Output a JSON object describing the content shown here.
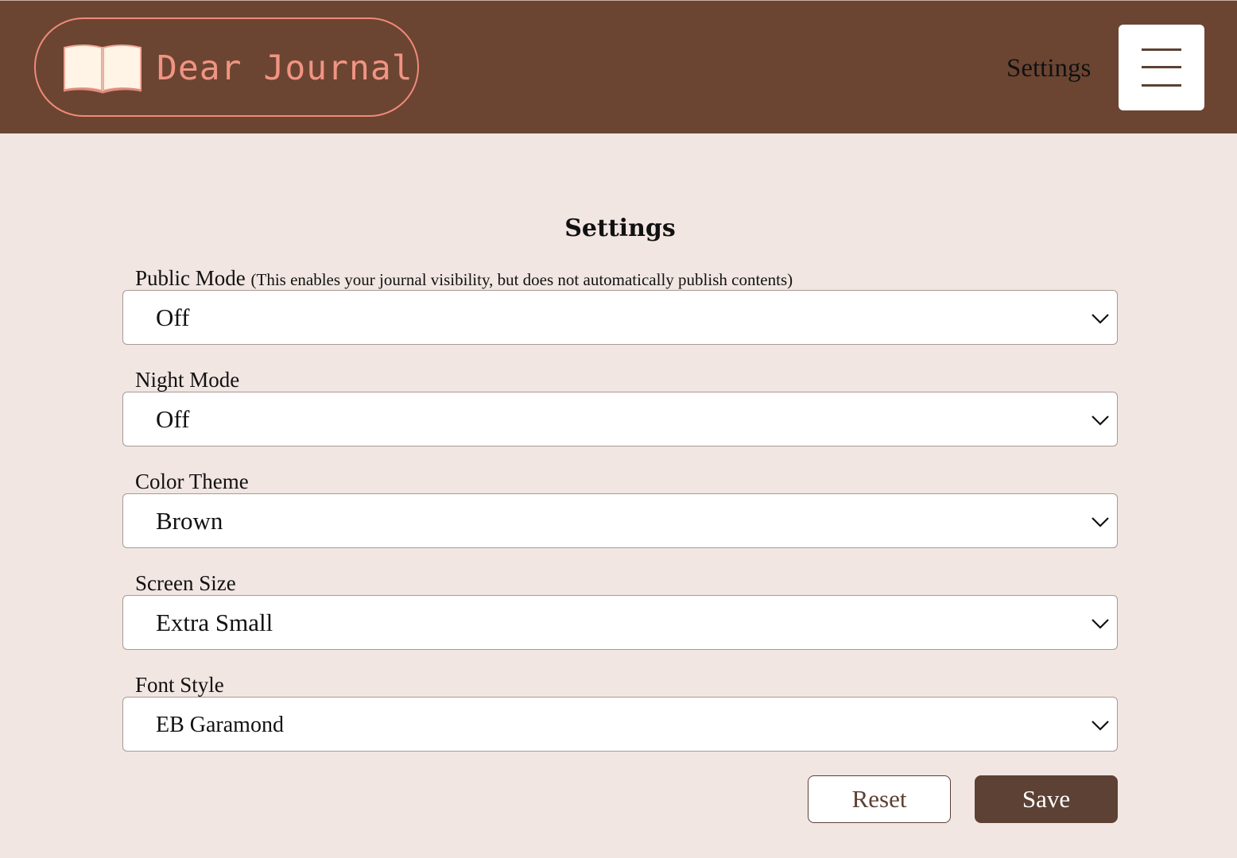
{
  "app": {
    "brand_title": "Dear Journal",
    "brand_icon": "open-book-icon"
  },
  "nav": {
    "settings_link": "Settings",
    "menu_icon": "hamburger-icon"
  },
  "page": {
    "title": "Settings"
  },
  "fields": {
    "public_mode": {
      "label": "Public Mode",
      "hint": "(This enables your journal visibility, but does not automatically publish contents)",
      "value": "Off"
    },
    "night_mode": {
      "label": "Night Mode",
      "value": "Off"
    },
    "color_theme": {
      "label": "Color Theme",
      "value": "Brown"
    },
    "screen_size": {
      "label": "Screen Size",
      "value": "Extra Small"
    },
    "font_style": {
      "label": "Font Style",
      "value": "EB Garamond"
    }
  },
  "actions": {
    "reset_label": "Reset",
    "save_label": "Save"
  },
  "colors": {
    "header_bg": "#6b4532",
    "page_bg": "#f1e6e2",
    "brand_accent": "#f19483",
    "button_dark": "#5c4134"
  }
}
